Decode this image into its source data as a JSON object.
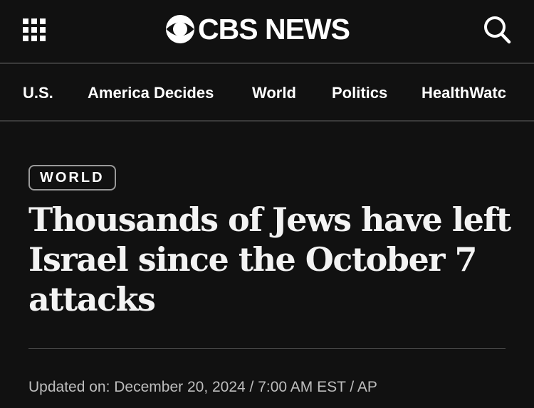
{
  "header": {
    "menu_icon": "grid-menu-icon",
    "logo_text": "CBS NEWS",
    "logo_icon": "cbs-eye-icon",
    "search_icon": "search-icon"
  },
  "nav": {
    "items": [
      {
        "label": "U.S."
      },
      {
        "label": "America Decides"
      },
      {
        "label": "World"
      },
      {
        "label": "Politics"
      },
      {
        "label": "HealthWatc"
      }
    ]
  },
  "article": {
    "category": "WORLD",
    "headline": "Thousands of Jews have left Israel since the October 7 attacks",
    "byline": "Updated on: December 20, 2024 / 7:00 AM EST / AP"
  },
  "colors": {
    "background": "#111111",
    "text": "#ffffff",
    "byline": "#bdbdbd",
    "divider": "#3a3a3a"
  }
}
